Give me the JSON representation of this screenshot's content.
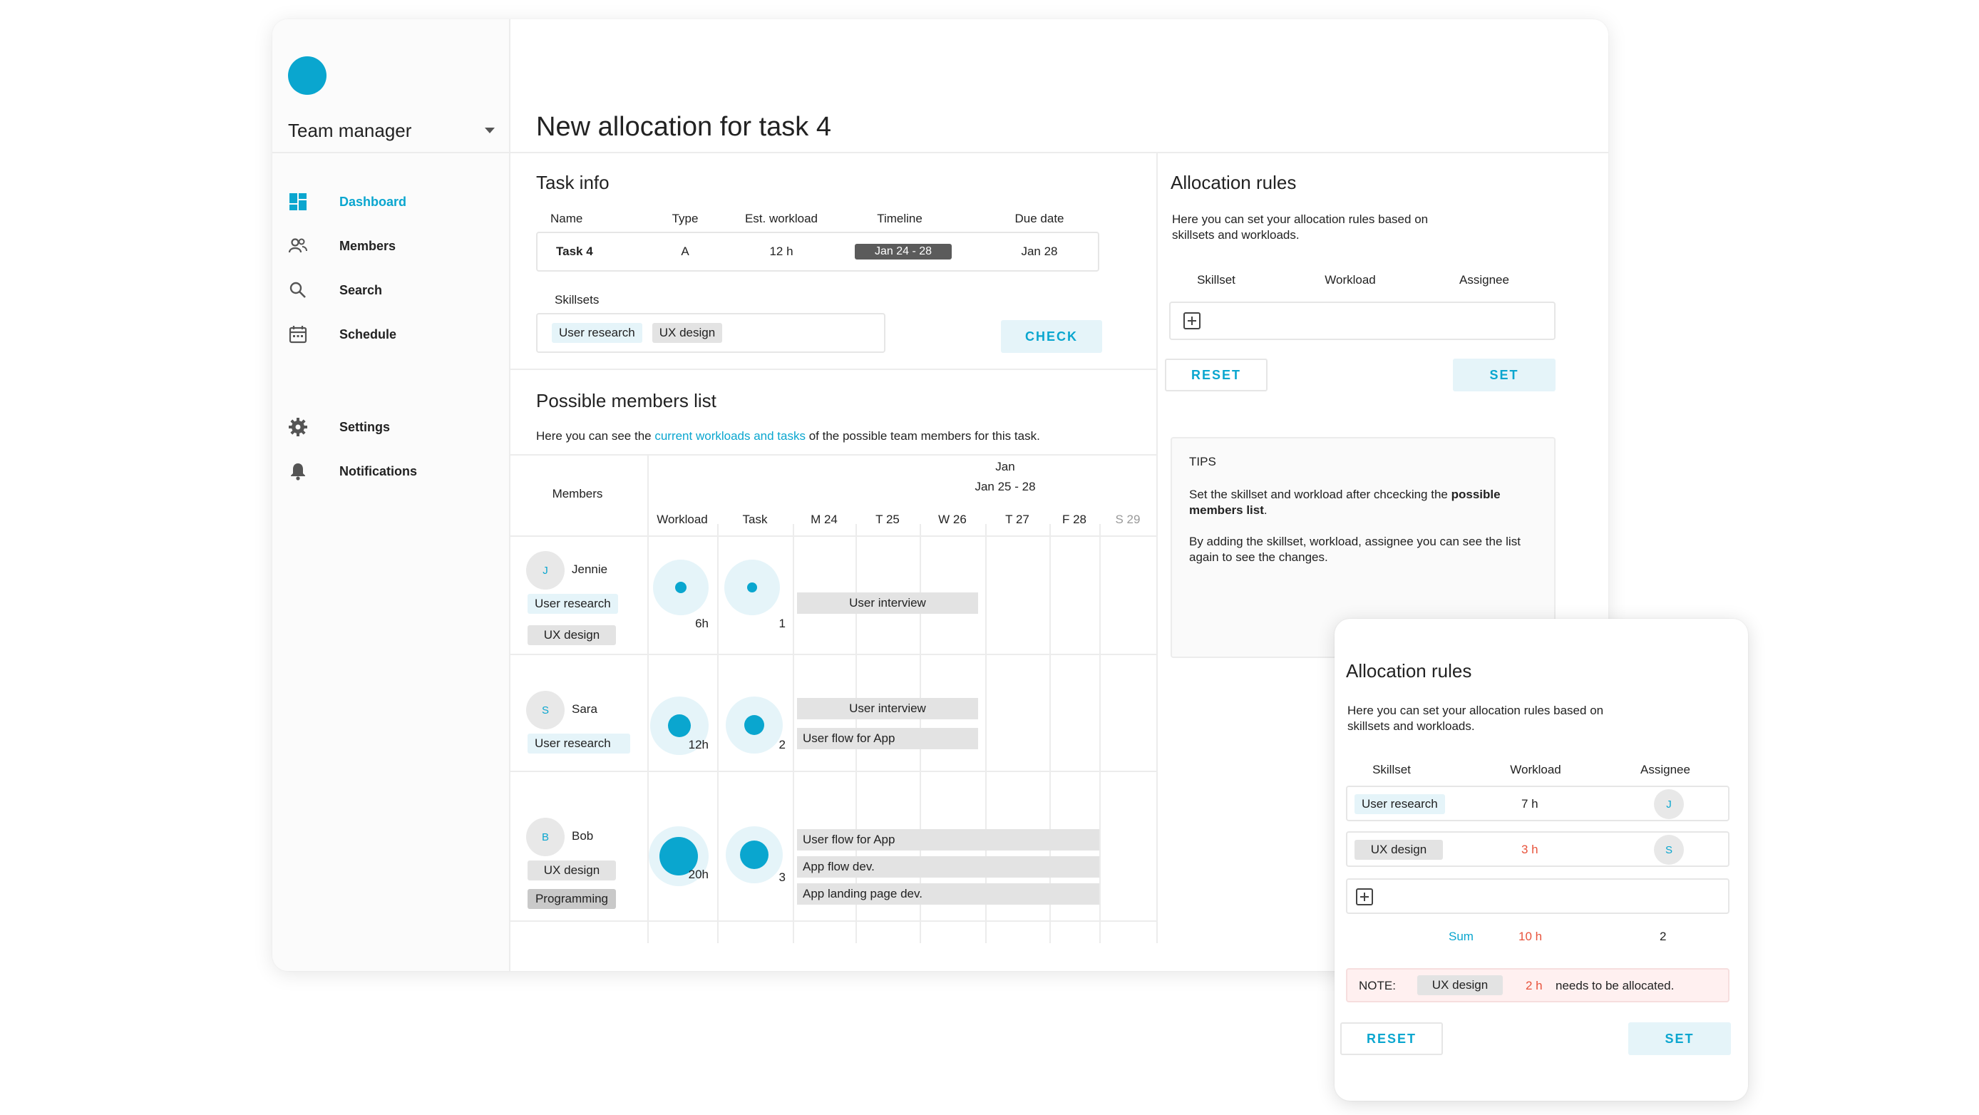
{
  "sidebar": {
    "team": "Team manager",
    "nav": [
      {
        "label": "Dashboard",
        "icon": "dashboard-icon",
        "active": true
      },
      {
        "label": "Members",
        "icon": "members-icon"
      },
      {
        "label": "Search",
        "icon": "search-icon"
      },
      {
        "label": "Schedule",
        "icon": "calendar-icon"
      },
      {
        "label": "Settings",
        "icon": "gear-icon"
      },
      {
        "label": "Notifications",
        "icon": "bell-icon"
      }
    ]
  },
  "page_title": "New allocation for task 4",
  "task_info": {
    "title": "Task info",
    "headers": [
      "Name",
      "Type",
      "Est. workload",
      "Timeline",
      "Due date"
    ],
    "row": {
      "name": "Task 4",
      "type": "A",
      "workload": "12 h",
      "timeline": "Jan 24 - 28",
      "due": "Jan 28"
    },
    "skillsets_label": "Skillsets",
    "skillsets": [
      "User research",
      "UX design"
    ],
    "check_label": "CHECK"
  },
  "members_list": {
    "title": "Possible members list",
    "desc_prefix": "Here you can see the ",
    "desc_link": "current workloads and tasks",
    "desc_suffix": " of the possible team members for this task.",
    "month": "Jan",
    "range": "Jan 25 - 28",
    "members_header": "Members",
    "col_workload": "Workload",
    "col_task": "Task",
    "days": [
      "M 24",
      "T 25",
      "W 26",
      "T 27",
      "F 28",
      "S 29"
    ],
    "members": [
      {
        "initial": "J",
        "name": "Jennie",
        "skills": [
          "User research",
          "UX design"
        ],
        "workload": "6h",
        "tasks": "1",
        "bars": [
          "User interview"
        ]
      },
      {
        "initial": "S",
        "name": "Sara",
        "skills": [
          "User research"
        ],
        "workload": "12h",
        "tasks": "2",
        "bars": [
          "User interview",
          "User flow for App"
        ]
      },
      {
        "initial": "B",
        "name": "Bob",
        "skills": [
          "UX design",
          "Programming"
        ],
        "workload": "20h",
        "tasks": "3",
        "bars": [
          "User flow for App",
          "App flow dev.",
          "App landing page dev."
        ]
      }
    ]
  },
  "allocation_rules": {
    "title": "Allocation rules",
    "desc": "Here you can set your allocation rules based on skillsets and workloads.",
    "headers": [
      "Skillset",
      "Workload",
      "Assignee"
    ],
    "reset": "RESET",
    "set": "SET"
  },
  "tips": {
    "title": "TIPS",
    "line1_prefix": "Set the skillset and workload after chcecking the ",
    "line1_bold": "possible members list",
    "line1_suffix": ".",
    "line2": "By adding the skillset, workload, assignee you can see the list again to see the changes."
  },
  "overlay": {
    "title": "Allocation rules",
    "desc": "Here you can set your allocation rules based on skillsets and workloads.",
    "headers": [
      "Skillset",
      "Workload",
      "Assignee"
    ],
    "rows": [
      {
        "skill": "User research",
        "workload": "7 h",
        "assignee": "J"
      },
      {
        "skill": "UX design",
        "workload": "3 h",
        "assignee": "S"
      }
    ],
    "sum_label": "Sum",
    "sum_workload": "10 h",
    "sum_assignees": "2",
    "note_label": "NOTE:",
    "note_skill": "UX design",
    "note_hours": "2 h",
    "note_text": "needs to be allocated.",
    "reset": "RESET",
    "set": "SET"
  },
  "colors": {
    "accent": "#0aa6cf",
    "warning": "#e8533c"
  }
}
